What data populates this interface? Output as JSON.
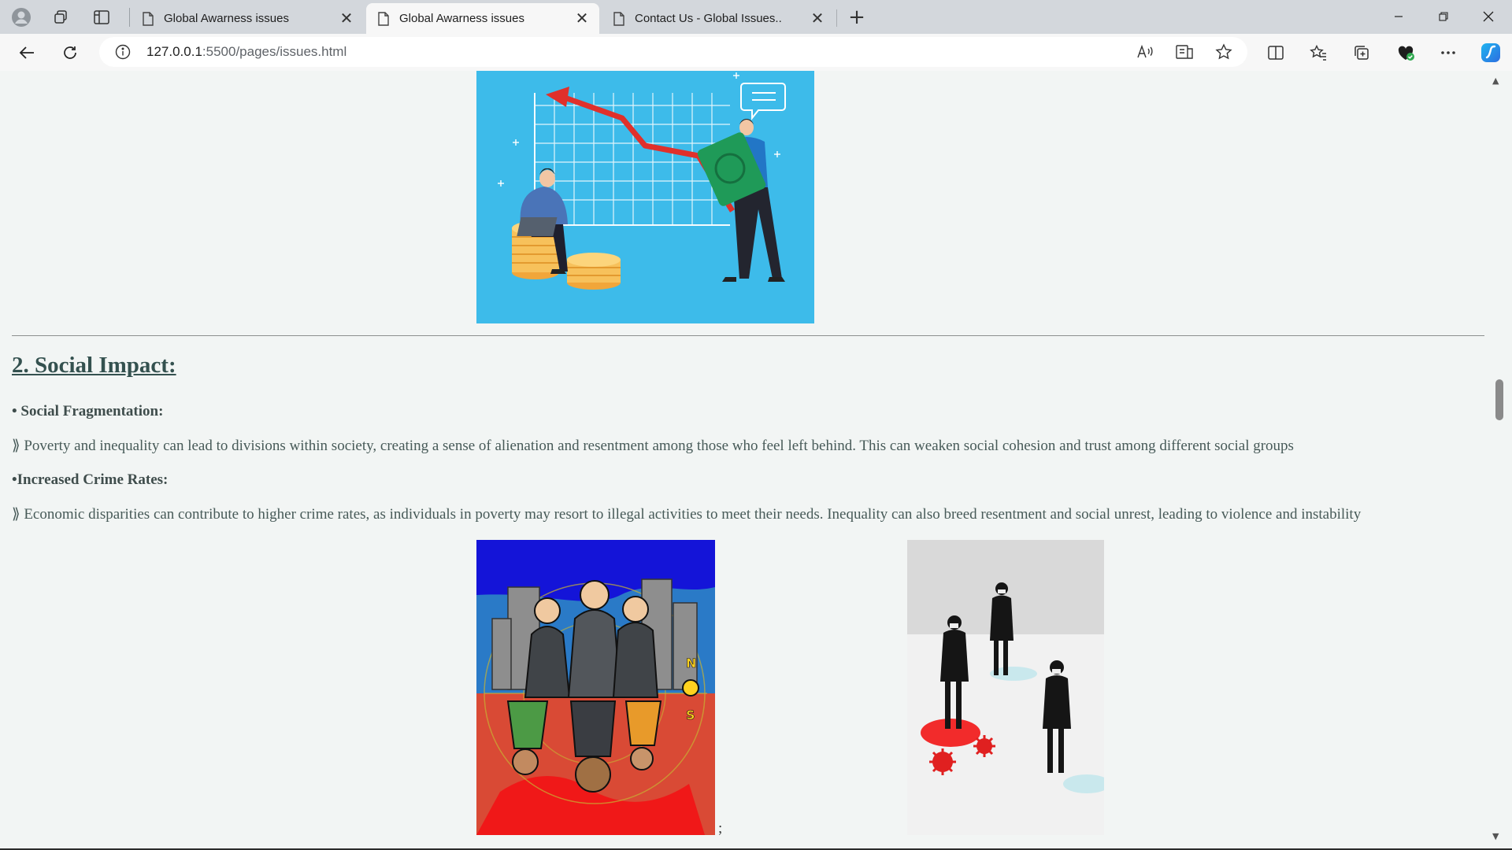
{
  "browser": {
    "tabs": [
      {
        "title": "Global Awarness issues",
        "active": false
      },
      {
        "title": "Global Awarness issues",
        "active": true
      },
      {
        "title": "Contact Us - Global Issues..",
        "active": false
      }
    ],
    "address": {
      "host": "127.0.0.1",
      "path": ":5500/pages/issues.html"
    },
    "new_tab_glyph": "+",
    "close_glyph": "✕"
  },
  "page": {
    "section_heading": "2. Social Impact:",
    "items": [
      {
        "title": "• Social Fragmentation:",
        "text": "⟫ Poverty and inequality can lead to divisions within society, creating a sense of alienation and resentment among those who feel left behind. This can weaken social cohesion and trust among different social groups"
      },
      {
        "title": "•Increased Crime Rates:",
        "text": "⟫ Economic disparities can contribute to higher crime rates, as individuals in poverty may resort to illegal activities to meet their needs. Inequality can also breed resentment and social unrest, leading to violence and instability"
      }
    ],
    "trailing_text": ";"
  },
  "colors": {
    "page_bg": "#f2f5f4",
    "heading": "#34514f",
    "chart_image_bg": "#3dbbea",
    "arrow_red": "#e0302b"
  }
}
